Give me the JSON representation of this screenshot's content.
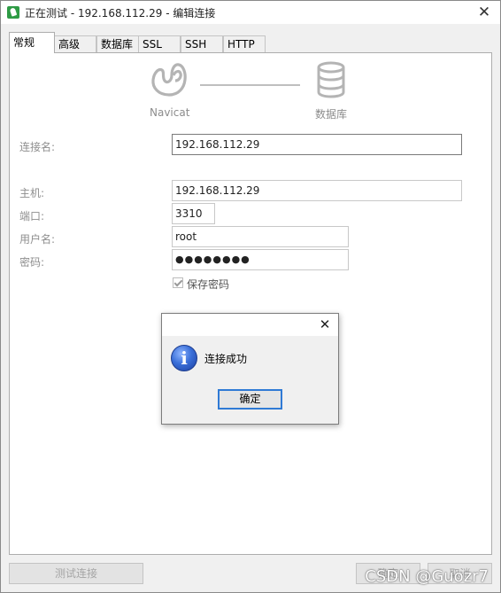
{
  "window": {
    "title": "正在测试 - 192.168.112.29 - 编辑连接",
    "close_glyph": "✕"
  },
  "tabs": [
    {
      "label": "常规",
      "active": true
    },
    {
      "label": "高级"
    },
    {
      "label": "数据库"
    },
    {
      "label": "SSL"
    },
    {
      "label": "SSH"
    },
    {
      "label": "HTTP"
    }
  ],
  "header": {
    "navicat_label": "Navicat",
    "db_label": "数据库"
  },
  "form": {
    "conn_name": {
      "label": "连接名:",
      "value": "192.168.112.29"
    },
    "host": {
      "label": "主机:",
      "value": "192.168.112.29"
    },
    "port": {
      "label": "端口:",
      "value": "3310"
    },
    "user": {
      "label": "用户名:",
      "value": "root"
    },
    "password": {
      "label": "密码:",
      "value": "●●●●●●●●"
    },
    "save_password": {
      "label": "保存密码",
      "checked": true
    }
  },
  "footer": {
    "test_button": "测试连接",
    "ok_button": "确定",
    "cancel_button": "取消"
  },
  "dialog": {
    "close_glyph": "✕",
    "icon_glyph": "i",
    "message": "连接成功",
    "ok_button": "确定"
  },
  "watermark": "CSDN @Guozr7",
  "colors": {
    "accent": "#2f7ad5",
    "brand": "#2e9b45"
  }
}
